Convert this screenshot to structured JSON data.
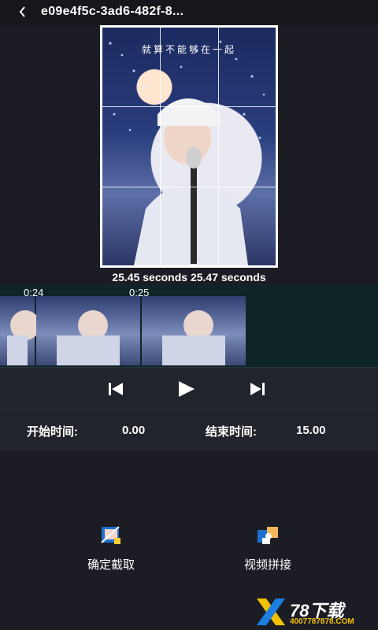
{
  "header": {
    "title": "e09e4f5c-3ad6-482f-8...",
    "back_icon": "chevron-left-icon"
  },
  "preview": {
    "caption": "就算不能够在一起",
    "timecodes": "25.45 seconds 25.47 seconds"
  },
  "timeline": {
    "ticks": [
      "0:24",
      "0:25"
    ]
  },
  "controls": {
    "prev_icon": "skip-previous-icon",
    "play_icon": "play-icon",
    "next_icon": "skip-next-icon"
  },
  "times": {
    "start_label": "开始时间:",
    "start_value": "0.00",
    "end_label": "结束时间:",
    "end_value": "15.00"
  },
  "actions": {
    "confirm_label": "确定截取",
    "merge_label": "视频拼接"
  },
  "watermark": {
    "brand": "78下载",
    "url": "4007787878.COM"
  },
  "colors": {
    "background": "#1c1d24",
    "header": "#16161c",
    "timeline": "#0e2427",
    "controls": "#22242c",
    "watermark_accent": "#f2c000"
  }
}
